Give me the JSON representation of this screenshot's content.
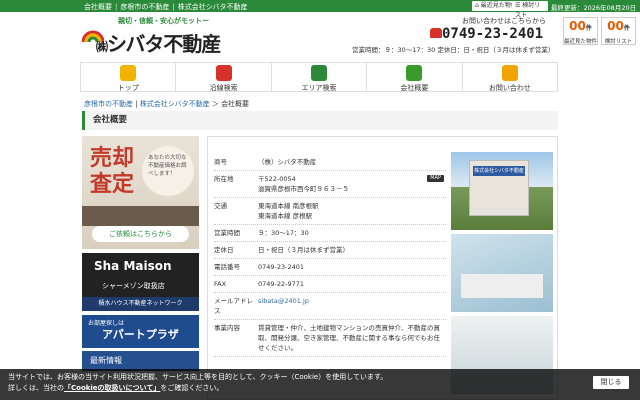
{
  "topbar": {
    "links": [
      "会社概要",
      "彦根市の不動産",
      "株式会社シバタ不動産"
    ],
    "recent_label": "最近見た物件",
    "compare_label": "検討リスト",
    "last_updated": "最終更新：2026年08月20日"
  },
  "logo": {
    "catch": "親切・信頼・安心がモットー",
    "prefix": "㈱",
    "name": "シバタ不動産"
  },
  "contact": {
    "label": "お問い合わせはこちらから",
    "tel": "0749-23-2401",
    "hours": "営業時間：９：30〜17：30 定休日：日・祝日（３月は休まず営業）"
  },
  "counters": [
    {
      "num": "00",
      "unit": "件",
      "label": "最近見た物件"
    },
    {
      "num": "00",
      "unit": "件",
      "label": "検討リスト"
    }
  ],
  "nav": [
    {
      "label": "トップ",
      "icon": "home-icon",
      "color": "#f2b400"
    },
    {
      "label": "沿線検索",
      "icon": "train-icon",
      "color": "#d6322a"
    },
    {
      "label": "エリア検索",
      "icon": "map-icon",
      "color": "#2a8a3a"
    },
    {
      "label": "会社概要",
      "icon": "clipboard-icon",
      "color": "#3a9a2a"
    },
    {
      "label": "お問い合わせ",
      "icon": "mail-icon",
      "color": "#f2a400"
    }
  ],
  "breadcrumb": {
    "items": [
      "彦根市の不動産",
      "株式会社シバタ不動産"
    ],
    "current": "会社概要"
  },
  "page_title": "会社概要",
  "banners": {
    "sell": {
      "big1": "売却",
      "big2": "査定",
      "note": "あなたの大切な不動産価格お調べします！",
      "request": "ご依頼はこちらから"
    },
    "shamaison": {
      "title": "Sha Maison",
      "sub": "シャーメゾン取扱店",
      "bottom": "積水ハウス不動産ネットワーク"
    },
    "apartplaza": {
      "top": "お部屋探しは",
      "title": "アパートプラザ"
    },
    "extra": "最新情報"
  },
  "company": {
    "rows": [
      {
        "k": "商号",
        "v": "（株）シバタ不動産"
      },
      {
        "k": "所在地",
        "v": "〒522-0054\n滋賀県彦根市西今町９６３－５",
        "map": "MAP"
      },
      {
        "k": "交通",
        "v": "東海道本線 南彦根駅\n東海道本線 彦根駅"
      },
      {
        "k": "営業時間",
        "v": "９：30〜17：30"
      },
      {
        "k": "定休日",
        "v": "日・祝日（３月は休まず営業）"
      },
      {
        "k": "電話番号",
        "v": "0749-23-2401"
      },
      {
        "k": "FAX",
        "v": "0749-22-9771"
      },
      {
        "k": "メールアドレス",
        "v": "sibata@2401.jp"
      },
      {
        "k": "事業内容",
        "v": "賃貸管理・仲介、土地建物マンションの売買仲介、不動産の買取、開発分譲、空き家管理、不動産に関する事なら何でもお任せください。"
      }
    ],
    "photo_sign": "株式会社シバタ不動産"
  },
  "cookie": {
    "line1": "当サイトでは、お客様の当サイト利用状況把握、サービス向上等を目的として、クッキー（Cookie）を使用しています。",
    "line2a": "詳しくは、当社の",
    "link": "「Cookieの取扱いについて」",
    "line2b": "をご確認ください。",
    "close": "閉じる"
  }
}
